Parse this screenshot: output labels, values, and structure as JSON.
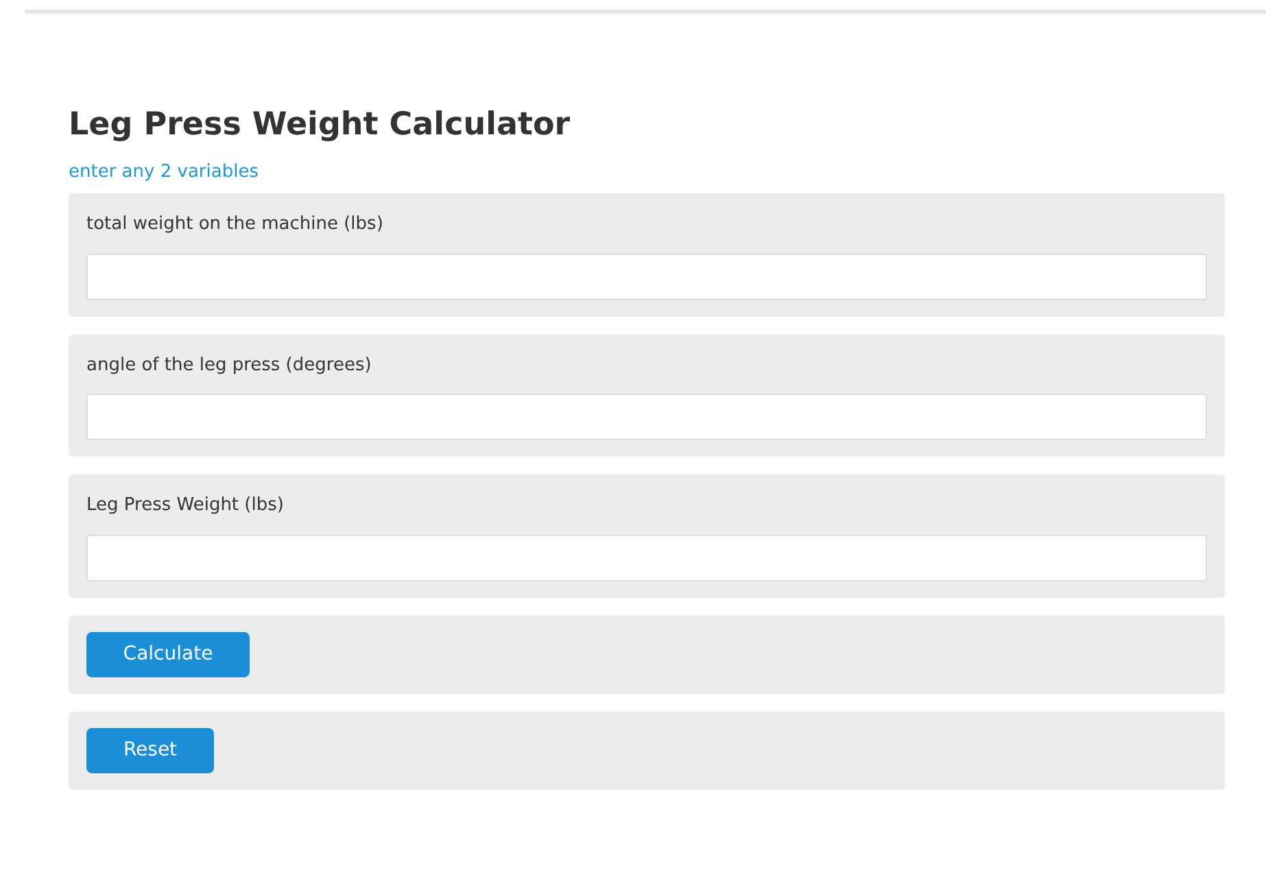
{
  "title": "Leg Press Weight Calculator",
  "subtitle": "enter any 2 variables",
  "fields": [
    {
      "label": "total weight on the machine (lbs)"
    },
    {
      "label": "angle of the leg press (degrees)"
    },
    {
      "label": "Leg Press Weight (lbs)"
    }
  ],
  "buttons": [
    {
      "label": "Calculate",
      "kind": "calculate"
    },
    {
      "label": "Reset",
      "kind": "reset"
    }
  ]
}
